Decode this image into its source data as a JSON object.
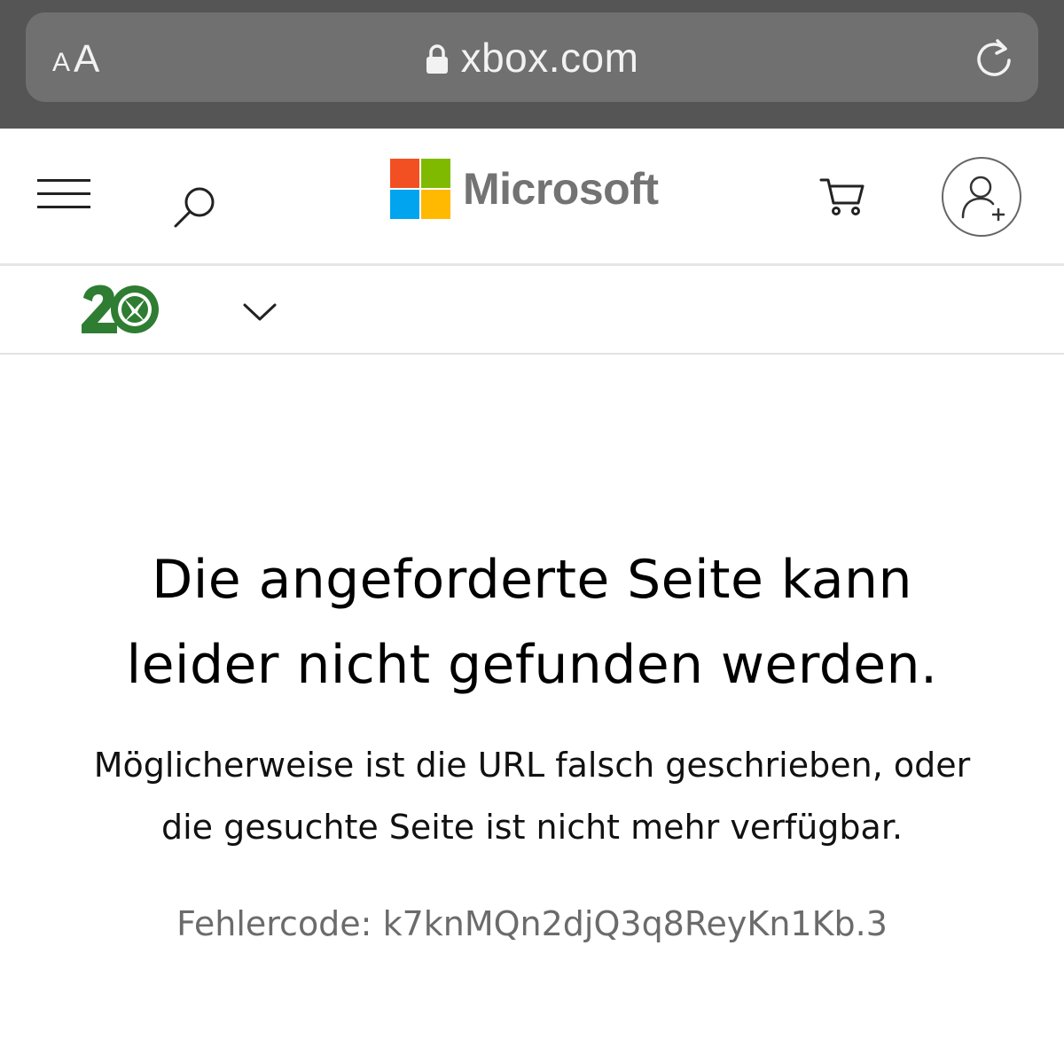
{
  "browser": {
    "reader_small": "A",
    "reader_large": "A",
    "url": "xbox.com",
    "lock_icon": "lock-icon",
    "reload_icon": "reload-icon"
  },
  "header": {
    "menu_icon": "hamburger-icon",
    "search_icon": "search-icon",
    "brand": "Microsoft",
    "brand_colors": [
      "#f25022",
      "#7fba00",
      "#00a4ef",
      "#ffb900"
    ],
    "cart_icon": "cart-icon",
    "account_icon": "add-user-icon"
  },
  "subnav": {
    "logo_icon": "xbox-20-anniversary-logo",
    "logo_color": "#2e7d32",
    "dropdown_icon": "chevron-down-icon"
  },
  "error": {
    "title_line1": "Die angeforderte Seite kann",
    "title_line2": "leider nicht gefunden werden.",
    "message_line1": "Möglicherweise ist die URL falsch geschrieben, oder",
    "message_line2": "die gesuchte Seite ist nicht mehr verfügbar.",
    "code": "Fehlercode: k7knMQn2djQ3q8ReyKn1Kb.3"
  }
}
